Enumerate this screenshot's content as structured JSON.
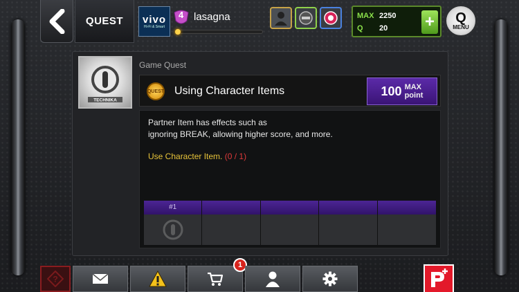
{
  "header": {
    "title": "QUEST",
    "avatar_brand": "vivo",
    "avatar_sub": "Hi-Fi & Smart",
    "level": "4",
    "username": "lasagna",
    "currency": {
      "max_label": "MAX",
      "max_value": "2250",
      "q_label": "Q",
      "q_value": "20",
      "plus_label": "+"
    },
    "menu": {
      "q": "Q",
      "label": "MENU"
    }
  },
  "quest": {
    "category": "Game Quest",
    "thumb_caption": "TECHNIKA",
    "coin_label": "QUEST",
    "title": "Using Character Items",
    "points_value": "100",
    "points_line1": "MAX",
    "points_line2": "point",
    "description_line1": "Partner Item has effects such as",
    "description_line2": "ignoring BREAK, allowing higher score, and more.",
    "objective": "Use Character Item.",
    "progress": "(0 / 1)",
    "slots": [
      {
        "header": "#1"
      },
      {
        "header": ""
      },
      {
        "header": ""
      },
      {
        "header": ""
      },
      {
        "header": ""
      }
    ]
  },
  "bottom": {
    "shop_badge": "1"
  },
  "colors": {
    "accent_purple": "#4c2594",
    "objective_yellow": "#e8c43a",
    "progress_red": "#e03a3a",
    "currency_green": "#8be04b"
  },
  "icons": [
    "back-arrow-icon",
    "person-icon",
    "ground-icon",
    "target-icon",
    "coin-icon",
    "help-icon",
    "mail-icon",
    "warning-icon",
    "cart-icon",
    "user-icon",
    "gear-icon",
    "p-plus-icon"
  ]
}
